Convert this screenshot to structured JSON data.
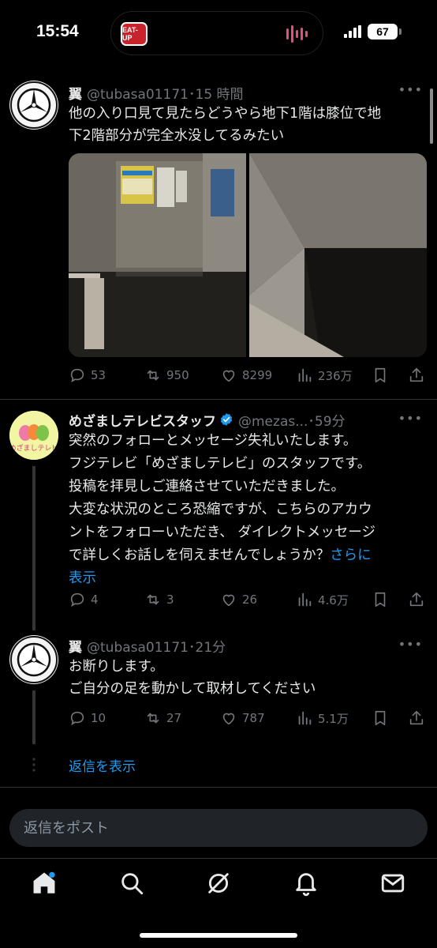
{
  "status_bar": {
    "time": "15:54",
    "island_app_label": "EAT-UP",
    "battery": "67"
  },
  "tweets": [
    {
      "name": "翼",
      "handle_time": "@tubasa01171･15 時間",
      "lines": [
        "他の入り口見て見たらどうやら地下1階は膝位で地",
        "下2階部分が完全水没してるみたい"
      ],
      "stats": {
        "replies": "53",
        "reposts": "950",
        "likes": "8299",
        "views": "236万"
      }
    },
    {
      "name": "めざましテレビスタッフ",
      "handle_time": "@mezas...･59分",
      "avatar_label": "めざましテレビ",
      "lines": [
        "突然のフォローとメッセージ失礼いたします。",
        "フジテレビ「めざましテレビ」のスタッフです。",
        "投稿を拝見しご連絡させていただきました。",
        "大変な状況のところ恐縮ですが、こちらのアカウ",
        "ントをフォローいただき、 ダイレクトメッセージ",
        "で詳しくお話しを伺えませんでしょうか？"
      ],
      "more_link": "さらに",
      "more_link_2": "表示",
      "stats": {
        "replies": "4",
        "reposts": "3",
        "likes": "26",
        "views": "4.6万"
      }
    },
    {
      "name": "翼",
      "handle_time": "@tubasa01171･21分",
      "lines": [
        "お断りします。",
        "ご自分の足を動かして取材してください"
      ],
      "stats": {
        "replies": "10",
        "reposts": "27",
        "likes": "787",
        "views": "5.1万"
      }
    }
  ],
  "show_replies": "返信を表示",
  "composer": {
    "placeholder": "返信をポスト"
  },
  "nav": [
    "home-icon",
    "search-icon",
    "grok-icon",
    "notifications-icon",
    "messages-icon"
  ],
  "colors": {
    "accent": "#1d9bf0",
    "muted": "#71767b",
    "background": "#000000"
  }
}
